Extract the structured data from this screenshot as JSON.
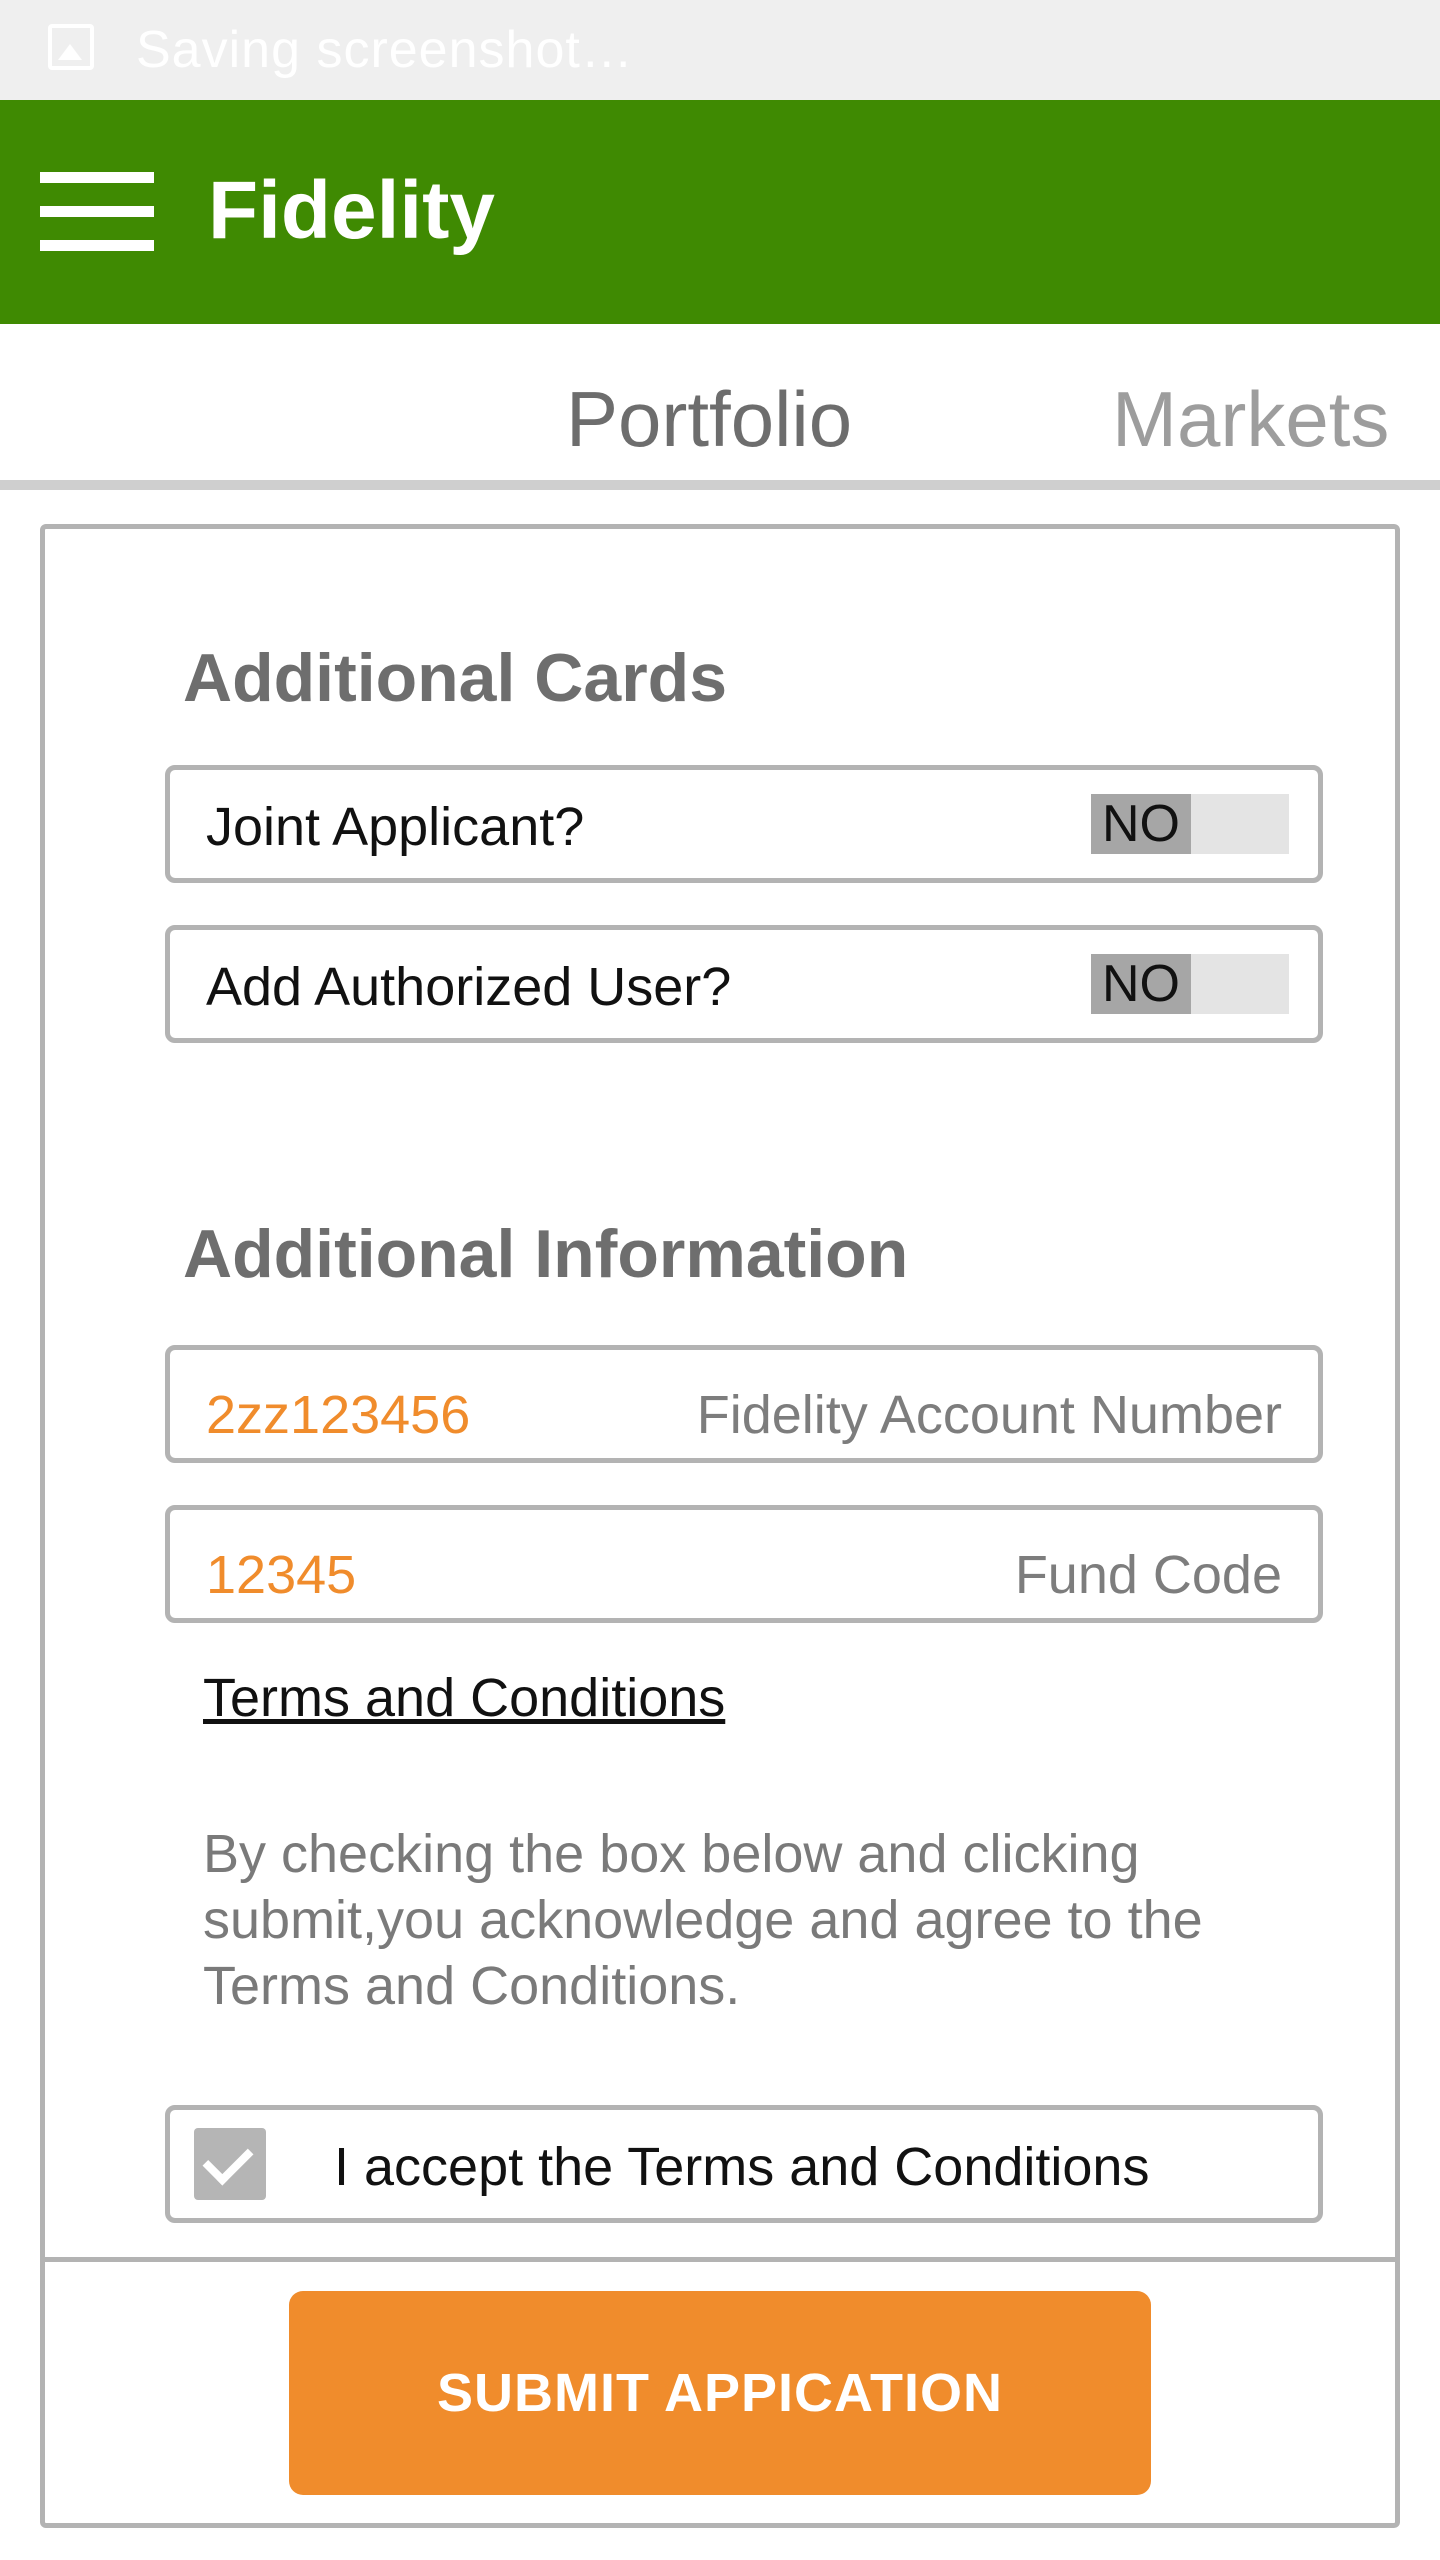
{
  "status_bar": {
    "text": "Saving screenshot…",
    "icon": "image-icon"
  },
  "app_bar": {
    "title": "Fidelity",
    "menu_icon": "hamburger-menu-icon",
    "color": "#3f8a02"
  },
  "tabs": [
    {
      "label": "Portfolio",
      "active": true
    },
    {
      "label": "Markets",
      "active": false
    }
  ],
  "additional_cards": {
    "title": "Additional Cards",
    "rows": [
      {
        "label": "Joint Applicant?",
        "toggle": "NO"
      },
      {
        "label": "Add Authorized User?",
        "toggle": "NO"
      }
    ]
  },
  "additional_information": {
    "title": "Additional Information",
    "fields": [
      {
        "value": "2zz123456",
        "hint": "Fidelity Account Number"
      },
      {
        "value": "12345",
        "hint": "Fund Code"
      }
    ]
  },
  "terms": {
    "link_label": "Terms and Conditions",
    "text": "By checking the box below and clicking submit,you acknowledge and agree to the Terms and Conditions.",
    "checkbox_label": "I accept the Terms and Conditions",
    "checked": true
  },
  "submit": {
    "label": "SUBMIT APPICATION",
    "color": "#f08c2c"
  }
}
